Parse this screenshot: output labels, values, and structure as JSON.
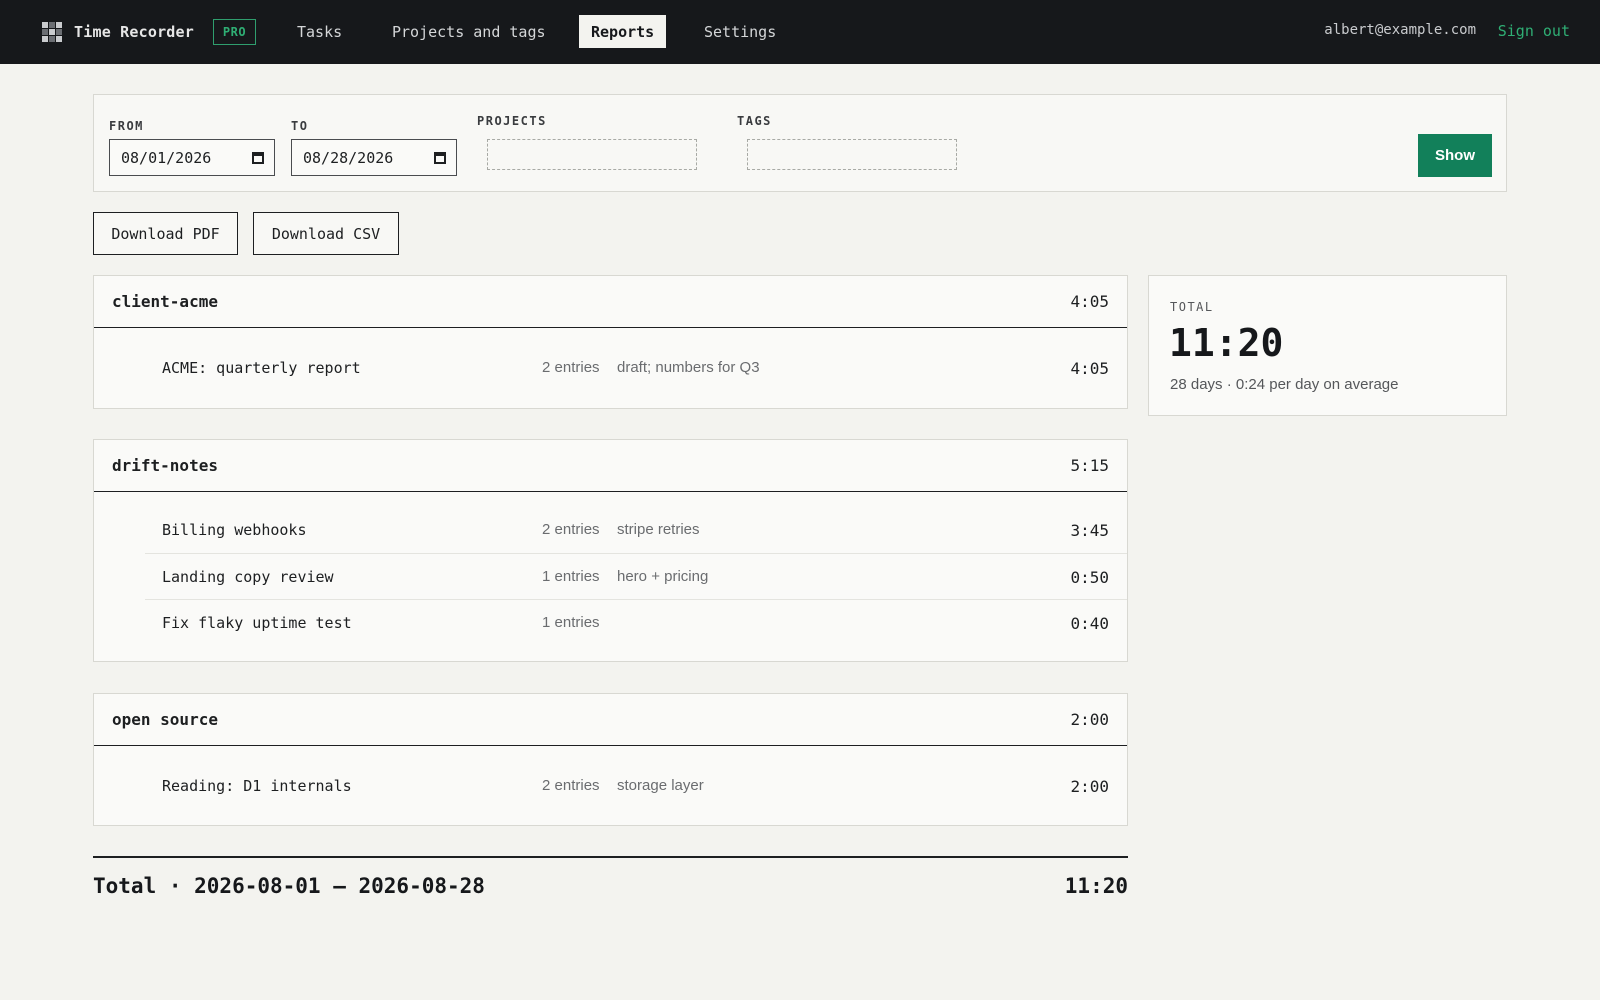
{
  "app": {
    "name": "Time Recorder",
    "badge": "PRO",
    "logo_icon": "grid-logo-icon"
  },
  "nav": {
    "items": [
      {
        "label": "Tasks",
        "active": false
      },
      {
        "label": "Projects and tags",
        "active": false
      },
      {
        "label": "Reports",
        "active": true
      },
      {
        "label": "Settings",
        "active": false
      }
    ],
    "user_email": "albert@example.com",
    "sign_out": "Sign out"
  },
  "filters": {
    "from_label": "FROM",
    "from_value": "08/01/2026",
    "to_label": "TO",
    "to_value": "08/28/2026",
    "projects_label": "PROJECTS",
    "tags_label": "TAGS",
    "show_label": "Show"
  },
  "downloads": {
    "pdf_label": "Download PDF",
    "csv_label": "Download CSV"
  },
  "groups": [
    {
      "name": "client-acme",
      "time": "4:05",
      "tasks": [
        {
          "name": "ACME: quarterly report",
          "count": "2 entries",
          "note": "draft; numbers for Q3",
          "time": "4:05"
        }
      ]
    },
    {
      "name": "drift-notes",
      "time": "5:15",
      "tasks": [
        {
          "name": "Billing webhooks",
          "count": "2 entries",
          "note": "stripe retries",
          "time": "3:45"
        },
        {
          "name": "Landing copy review",
          "count": "1 entries",
          "note": "hero + pricing",
          "time": "0:50"
        },
        {
          "name": "Fix flaky uptime test",
          "count": "1 entries",
          "note": "",
          "time": "0:40"
        }
      ]
    },
    {
      "name": "open source",
      "time": "2:00",
      "tasks": [
        {
          "name": "Reading: D1 internals",
          "count": "2 entries",
          "note": "storage layer",
          "time": "2:00"
        }
      ]
    }
  ],
  "total_card": {
    "label": "TOTAL",
    "value": "11:20",
    "subtext": "28 days · 0:24 per day on average"
  },
  "footer": {
    "summary": "Total · 2026-08-01 – 2026-08-28",
    "total": "11:20"
  },
  "colors": {
    "accent": "#12805a",
    "topbar_bg": "#16181b",
    "page_bg": "#f3f3ef",
    "link": "#2fae74"
  }
}
